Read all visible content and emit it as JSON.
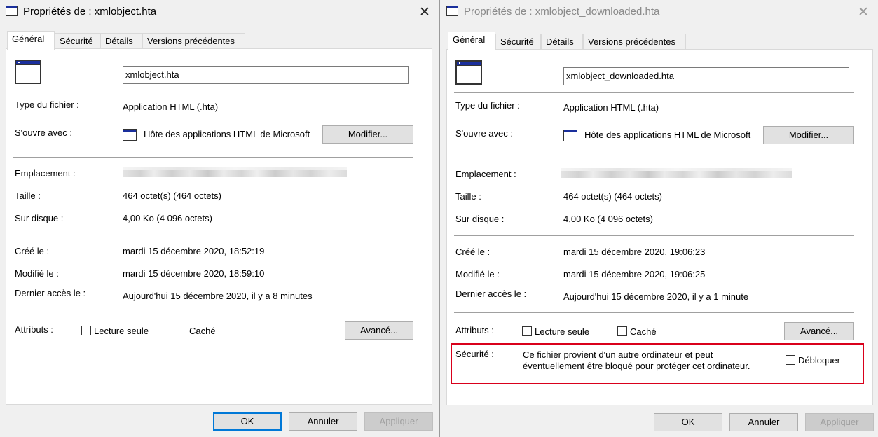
{
  "left": {
    "title": "Propriétés de : xmlobject.hta",
    "tabs": [
      "Général",
      "Sécurité",
      "Détails",
      "Versions précédentes"
    ],
    "filename": "xmlobject.hta",
    "type_label": "Type du fichier :",
    "type_value": "Application HTML (.hta)",
    "opens_label": "S'ouvre avec :",
    "opens_value": "Hôte des applications HTML de Microsoft",
    "change_button": "Modifier...",
    "location_label": "Emplacement :",
    "size_label": "Taille :",
    "size_value": "464 octet(s) (464 octets)",
    "disk_label": "Sur disque :",
    "disk_value": "4,00 Ko (4 096 octets)",
    "created_label": "Créé le :",
    "created_value": "mardi 15 décembre 2020, 18:52:19",
    "modified_label": "Modifié le :",
    "modified_value": "mardi 15 décembre 2020, 18:59:10",
    "accessed_label": "Dernier accès le :",
    "accessed_value": "Aujourd'hui 15 décembre 2020, il y a 8 minutes",
    "attributes_label": "Attributs :",
    "readonly_label": "Lecture seule",
    "hidden_label": "Caché",
    "advanced_button": "Avancé...",
    "ok": "OK",
    "cancel": "Annuler",
    "apply": "Appliquer"
  },
  "right": {
    "title": "Propriétés de : xmlobject_downloaded.hta",
    "tabs": [
      "Général",
      "Sécurité",
      "Détails",
      "Versions précédentes"
    ],
    "filename": "xmlobject_downloaded.hta",
    "type_label": "Type du fichier :",
    "type_value": "Application HTML (.hta)",
    "opens_label": "S'ouvre avec :",
    "opens_value": "Hôte des applications HTML de Microsoft",
    "change_button": "Modifier...",
    "location_label": "Emplacement :",
    "size_label": "Taille :",
    "size_value": "464 octet(s) (464 octets)",
    "disk_label": "Sur disque :",
    "disk_value": "4,00 Ko (4 096 octets)",
    "created_label": "Créé le :",
    "created_value": "mardi 15 décembre 2020, 19:06:23",
    "modified_label": "Modifié le :",
    "modified_value": "mardi 15 décembre 2020, 19:06:25",
    "accessed_label": "Dernier accès le :",
    "accessed_value": "Aujourd'hui 15 décembre 2020, il y a 1 minute",
    "attributes_label": "Attributs :",
    "readonly_label": "Lecture seule",
    "hidden_label": "Caché",
    "advanced_button": "Avancé...",
    "security_label": "Sécurité :",
    "security_line1": "Ce fichier provient d'un autre ordinateur et peut",
    "security_line2": "éventuellement être bloqué pour protéger cet ordinateur.",
    "unblock_label": "Débloquer",
    "ok": "OK",
    "cancel": "Annuler",
    "apply": "Appliquer"
  },
  "colors": {
    "highlight_box": "#d9001b",
    "primary_button_border": "#0078d7",
    "icon_titlebar": "#1a2f9c"
  }
}
